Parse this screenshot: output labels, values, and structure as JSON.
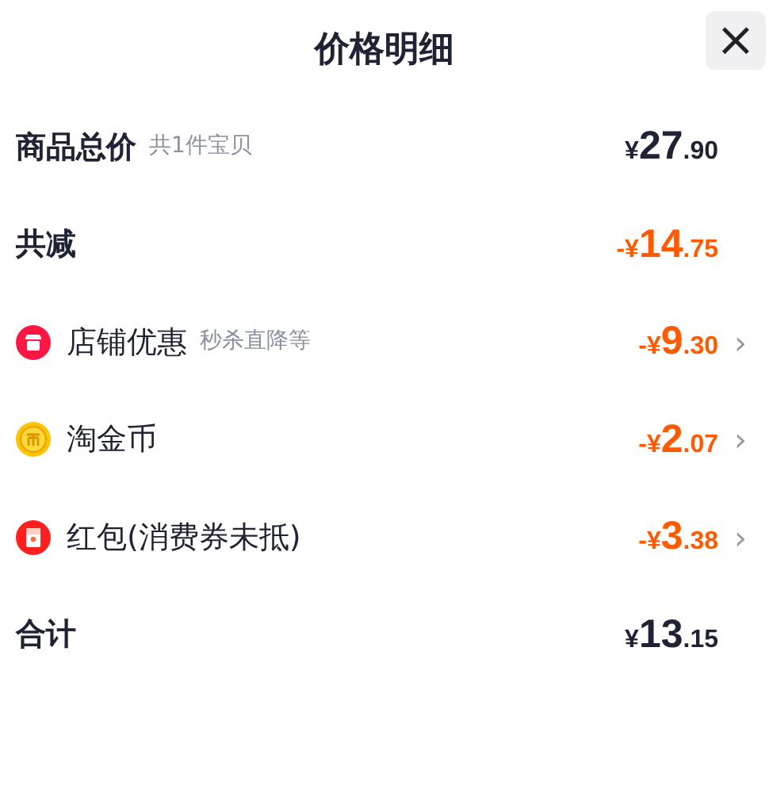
{
  "title": "价格明细",
  "close": "×",
  "rows": [
    {
      "kind": "total",
      "label": "商品总价",
      "note": "共1件宝贝",
      "price": {
        "sign": "¥",
        "integer": "27",
        "decimal": ".90"
      }
    },
    {
      "kind": "discount",
      "label": "共减",
      "price": {
        "sign": "-¥",
        "integer": "14",
        "decimal": ".75"
      }
    },
    {
      "kind": "item",
      "label": "店铺优惠",
      "note": "秒杀直降等",
      "price": {
        "sign": "-¥",
        "integer": "9",
        "decimal": ".30"
      },
      "chevron": "›"
    },
    {
      "kind": "item",
      "label": "淘金币",
      "price": {
        "sign": "-¥",
        "integer": "2",
        "decimal": ".07"
      },
      "chevron": "›"
    },
    {
      "kind": "item",
      "label": "红包(消费券未抵)",
      "price": {
        "sign": "-¥",
        "integer": "3",
        "decimal": ".38"
      },
      "chevron": "›"
    },
    {
      "kind": "total",
      "label": "合计",
      "price": {
        "sign": "¥",
        "integer": "13",
        "decimal": ".15"
      }
    }
  ]
}
